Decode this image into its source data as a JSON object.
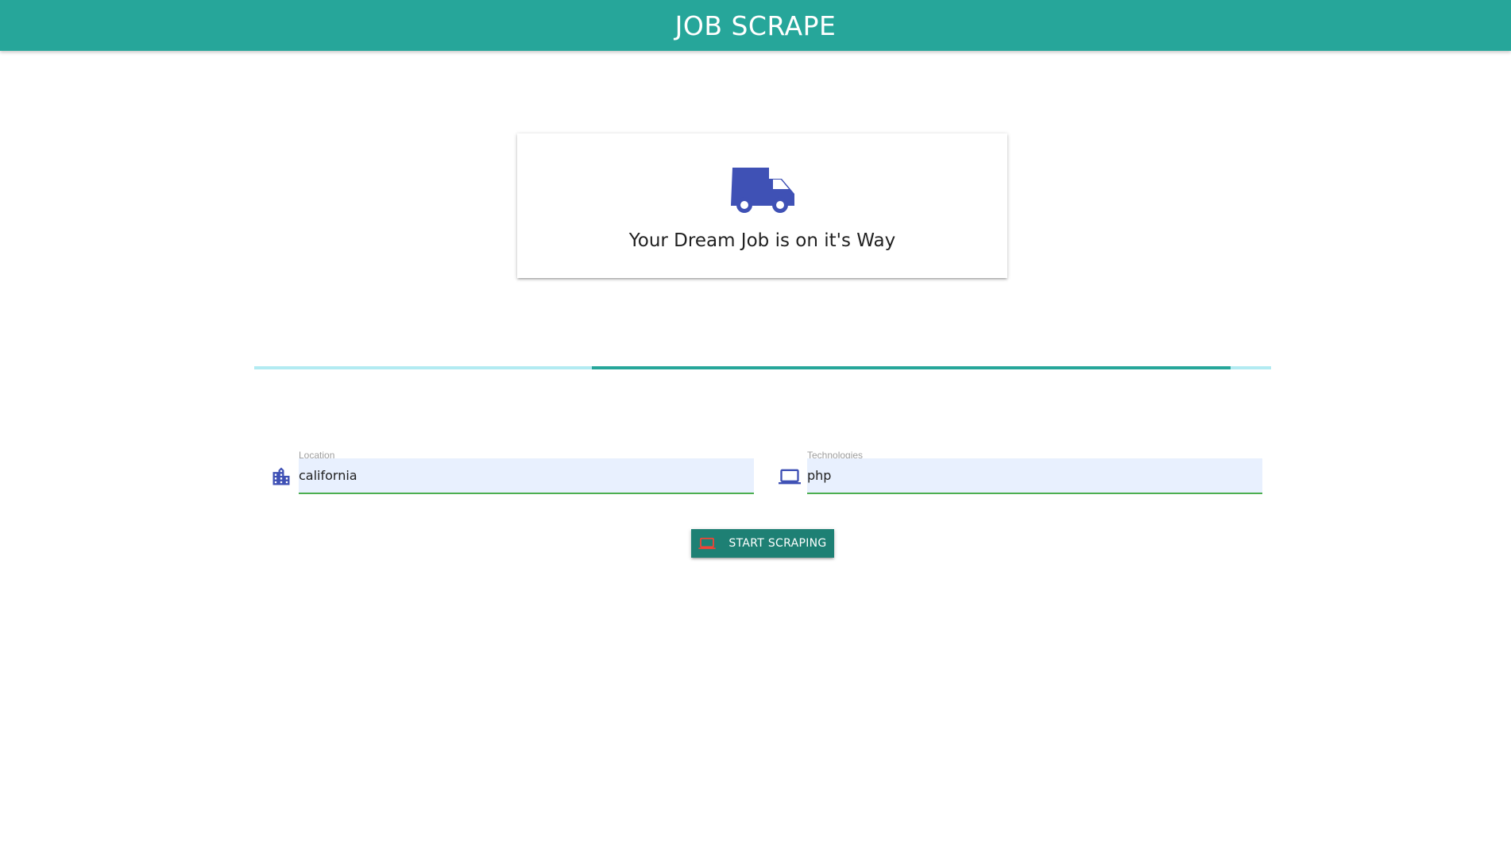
{
  "navbar": {
    "brand": "JOB SCRAPE",
    "color": "#26a69a"
  },
  "card": {
    "icon": "truck-icon",
    "icon_color": "#3f51b5",
    "title": "Your Dream Job is on it's Way"
  },
  "progress": {
    "track_color": "#b2ebf2",
    "bar_color": "#26a69a",
    "start_fraction": 0.332,
    "end_fraction": 0.96
  },
  "form": {
    "location": {
      "label": "Location",
      "value": "california",
      "icon": "location-city-icon"
    },
    "technologies": {
      "label": "Technologies",
      "value": "php",
      "icon": "laptop-icon"
    },
    "submit": {
      "label": "START SCRAPING",
      "icon": "laptop-icon",
      "icon_color": "#f44336",
      "color": "#1e8074"
    }
  }
}
